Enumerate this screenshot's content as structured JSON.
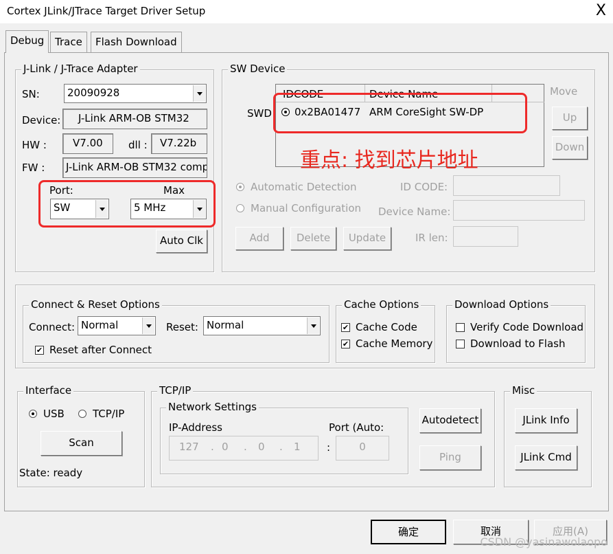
{
  "window": {
    "title": "Cortex JLink/JTrace Target Driver Setup",
    "close_glyph": "X"
  },
  "tabs": [
    {
      "label": "Debug"
    },
    {
      "label": "Trace"
    },
    {
      "label": "Flash Download"
    }
  ],
  "adapter": {
    "legend": "J-Link / J-Trace Adapter",
    "sn_label": "SN:",
    "sn_value": "20090928",
    "device_label": "Device:",
    "device_value": "J-Link ARM-OB STM32",
    "hw_label": "HW :",
    "hw_value": "V7.00",
    "dll_label": "dll :",
    "dll_value": "V7.22b",
    "fw_label": "FW :",
    "fw_value": "J-Link ARM-OB STM32 comp",
    "port_label": "Port:",
    "port_value": "SW",
    "max_label": "Max",
    "max_value": "5 MHz",
    "autoclk_label": "Auto Clk"
  },
  "sw_device": {
    "legend": "SW Device",
    "swd_label": "SWD",
    "columns": [
      "IDCODE",
      "Device Name"
    ],
    "rows": [
      {
        "idcode": "0x2BA01477",
        "name": "ARM CoreSight SW-DP"
      }
    ],
    "move_label": "Move",
    "up_label": "Up",
    "down_label": "Down",
    "auto_detect_label": "Automatic Detection",
    "manual_config_label": "Manual Configuration",
    "idcode_label": "ID CODE:",
    "devname_label": "Device Name:",
    "irlen_label": "IR len:",
    "add_label": "Add",
    "delete_label": "Delete",
    "update_label": "Update"
  },
  "annotation": {
    "text": "重点: 找到芯片地址",
    "color": "#e8281f"
  },
  "connect_reset": {
    "legend": "Connect & Reset Options",
    "connect_label": "Connect:",
    "connect_value": "Normal",
    "reset_label": "Reset:",
    "reset_value": "Normal",
    "reset_after_connect": "Reset after Connect"
  },
  "cache": {
    "legend": "Cache Options",
    "cache_code": "Cache Code",
    "cache_memory": "Cache Memory"
  },
  "download": {
    "legend": "Download Options",
    "verify": "Verify Code Download",
    "to_flash": "Download to Flash"
  },
  "interface": {
    "legend": "Interface",
    "usb": "USB",
    "tcpip": "TCP/IP",
    "scan": "Scan",
    "state": "State: ready"
  },
  "tcpip": {
    "legend": "TCP/IP",
    "network_legend": "Network Settings",
    "ip_label": "IP-Address",
    "ip": [
      "127",
      "0",
      "0",
      "1"
    ],
    "port_label": "Port (Auto:",
    "port_value": "0",
    "autodetect": "Autodetect",
    "ping": "Ping"
  },
  "misc": {
    "legend": "Misc",
    "jlink_info": "JLink Info",
    "jlink_cmd": "JLink Cmd"
  },
  "footer": {
    "ok": "确定",
    "cancel": "取消",
    "apply": "应用(A)"
  },
  "watermark": "CSDN @yasinawolaopo"
}
